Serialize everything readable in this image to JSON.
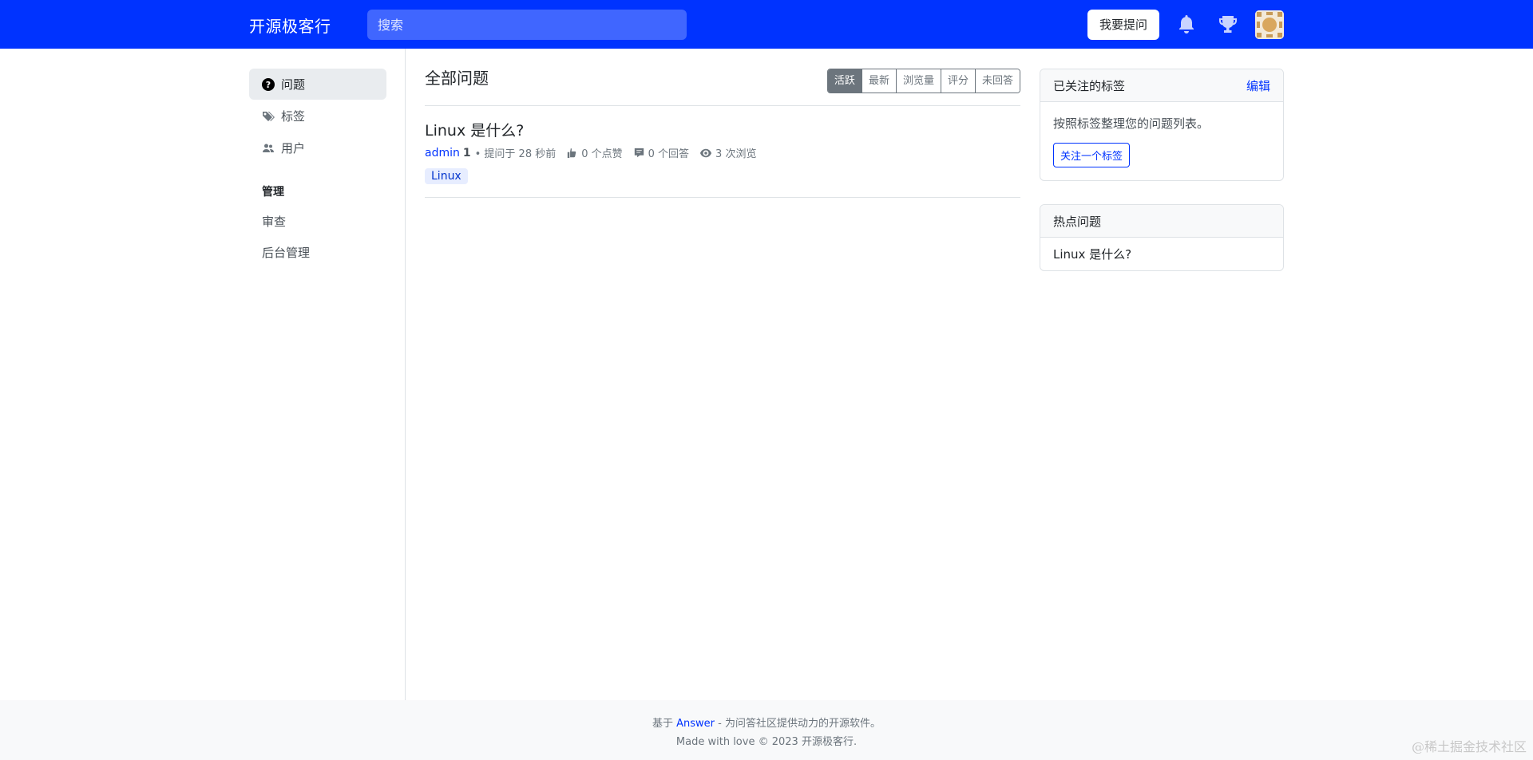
{
  "header": {
    "brand": "开源极客行",
    "search_placeholder": "搜索",
    "ask_button": "我要提问",
    "icons": [
      "bell-icon",
      "trophy-icon"
    ],
    "colors": {
      "topbar": "#0033ff"
    }
  },
  "sidebar": {
    "items": [
      {
        "label": "问题",
        "icon": "question-circle-icon",
        "active": true
      },
      {
        "label": "标签",
        "icon": "tags-icon"
      },
      {
        "label": "用户",
        "icon": "people-icon"
      }
    ],
    "admin_heading": "管理",
    "admin_items": [
      {
        "label": "审查"
      },
      {
        "label": "后台管理"
      }
    ]
  },
  "main": {
    "title": "全部问题",
    "sort_tabs": [
      "活跃",
      "最新",
      "浏览量",
      "评分",
      "未回答"
    ],
    "active_sort": "活跃",
    "questions": [
      {
        "title": "Linux 是什么?",
        "author": "admin",
        "reputation": "1",
        "time": "• 提问于 28 秒前",
        "votes": "0 个点赞",
        "answers": "0 个回答",
        "views": "3 次浏览",
        "tag": "Linux"
      }
    ]
  },
  "followed_tags": {
    "title": "已关注的标签",
    "edit": "编辑",
    "desc": "按照标签整理您的问题列表。",
    "button": "关注一个标签"
  },
  "hot_questions": {
    "title": "热点问题",
    "items": [
      "Linux 是什么?"
    ]
  },
  "footer": {
    "prefix": "基于",
    "link": "Answer",
    "suffix": "- 为问答社区提供动力的开源软件。",
    "line2": "Made with love © 2023 开源极客行."
  },
  "watermark": "@稀土掘金技术社区"
}
